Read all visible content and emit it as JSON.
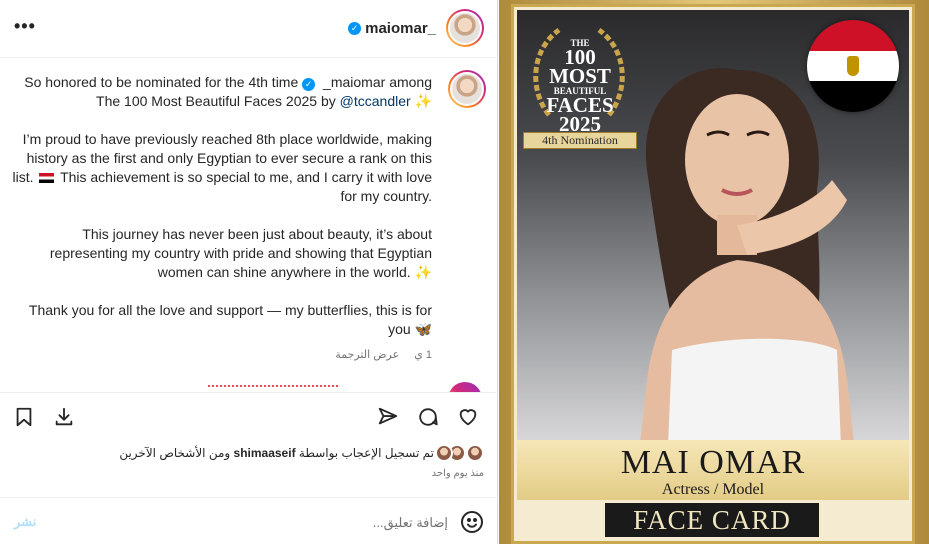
{
  "header": {
    "username": "maiomar_",
    "verified": true,
    "more_icon": "ellipsis-icon"
  },
  "caption": {
    "line1_prefix": "So honored to be nominated for the 4th time",
    "line1_mention": "_maiomar",
    "line1_suffix": "among The 100 Most Beautiful Faces 2025 by",
    "line1_handle": "@tccandler",
    "para2_a": "I’m proud to have previously reached 8th place worldwide, making history as the first and only Egyptian to ever secure a rank on this list.",
    "para2_b": "This achievement is so special to me, and I carry it with love for my country.",
    "para3": "This journey has never been just about beauty, it’s about representing my country with pride and showing that Egyptian women can shine anywhere in the world.",
    "para4": "Thank you for all the love and support — my butterflies, this is for you",
    "sparkle": "✨",
    "butterfly": "🦋",
    "age": "1 ي",
    "translate": "عرض الترجمة"
  },
  "actions": {
    "like_icon": "heart-icon",
    "comment_icon": "comment-icon",
    "share_icon": "send-icon",
    "save_icon": "bookmark-icon",
    "download_icon": "download-icon"
  },
  "likes": {
    "prefix": "تم تسجيل الإعجاب بواسطة",
    "user": "shimaaseif",
    "suffix": "ومن الأشخاص الآخرين",
    "time": "منذ يوم واحد"
  },
  "composer": {
    "placeholder": "إضافة تعليق...",
    "post_label": "نشر",
    "emoji_icon": "smiley-icon"
  },
  "photo": {
    "badge_top": "THE",
    "badge_title_1": "100",
    "badge_title_2": "MOST",
    "badge_title_3": "BEAUTIFUL",
    "badge_title_4": "FACES",
    "badge_year": "2025",
    "nomination": "4th Nomination",
    "name": "MAI OMAR",
    "role": "Actress / Model",
    "card": "FACE CARD",
    "colors": {
      "gold": "#caa84f",
      "flag_red": "#ce1126",
      "verified_blue": "#0095f6"
    }
  }
}
